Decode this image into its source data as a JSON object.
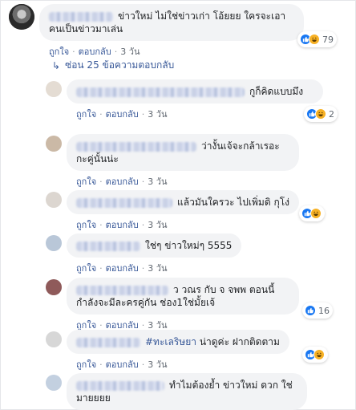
{
  "top_comment": {
    "text": "ข่าวใหม่ ไม่ใช่ข่าวเก่า โอ้ยยย ใครจะเอาคนเป็นข่าวมาเล่น",
    "like_label": "ถูกใจ",
    "reply_label": "ตอบกลับ",
    "time": "3 วัน",
    "reaction_count": "79"
  },
  "replies_toggle": {
    "icon": "reply-arrow-icon",
    "label": "ซ่อน 25 ข้อความตอบกลับ"
  },
  "replies": [
    {
      "text": "กูก็คิดแบบมึง",
      "like_label": "ถูกใจ",
      "reply_label": "ตอบกลับ",
      "time": "3 วัน",
      "reaction_count": "2",
      "reactions": [
        "like",
        "haha"
      ]
    },
    {
      "text": "ว่างั้นเจ้จะกล้าเรอะกะคู่นั้นน่ะ",
      "like_label": "ถูกใจ",
      "reply_label": "ตอบกลับ",
      "time": "3 วัน",
      "reaction_count": "",
      "reactions": []
    },
    {
      "text": "แล้วมันใครวะ ไปเพิ่มดิ กุโง่",
      "like_label": "ถูกใจ",
      "reply_label": "ตอบกลับ",
      "time": "3 วัน",
      "reaction_count": "",
      "reactions": [
        "like",
        "haha"
      ]
    },
    {
      "text": "ใช่ๆ ข่าวใหม่ๆ 5555",
      "like_label": "ถูกใจ",
      "reply_label": "ตอบกลับ",
      "time": "3 วัน",
      "reaction_count": "",
      "reactions": []
    },
    {
      "text": "ว วณร กับ จ จพพ ตอนนี้กำลังจะมีละครคู่กัน ช่อง1ใช่มั้ยเจ้",
      "like_label": "ถูกใจ",
      "reply_label": "ตอบกลับ",
      "time": "3 วัน",
      "reaction_count": "16",
      "reactions": [
        "like"
      ]
    },
    {
      "text": "#ทะเลริษยา น่าดูค่ะ ฝากติดตาม",
      "hashtag": "#ทะเลริษยา",
      "rest": " น่าดูค่ะ ฝากติดตาม",
      "like_label": "ถูกใจ",
      "reply_label": "ตอบกลับ",
      "time": "3 วัน",
      "reaction_count": "",
      "reactions": [
        "like",
        "haha"
      ]
    },
    {
      "text": "ทำไมต้องย้ำ ข่าวใหม่ ดวก ใช่มายยยย",
      "like_label": "",
      "reply_label": "",
      "time": "",
      "reaction_count": "",
      "reactions": []
    }
  ],
  "colors": {
    "link": "#385898",
    "bubble": "#f2f3f5",
    "like": "#1877f2",
    "haha": "#f7b125"
  }
}
